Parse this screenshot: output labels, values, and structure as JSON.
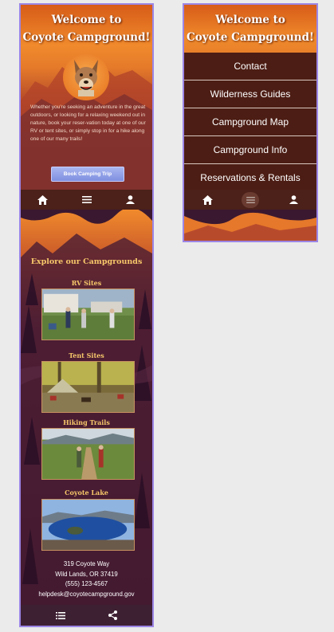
{
  "site": {
    "title_line1": "Welcome to",
    "title_line2": "Coyote Campground!"
  },
  "hero": {
    "intro": "Whether you're seeking an adventure in the great outdoors, or looking for a relaxing weekend out in nature, book your reser-vation today at one of our RV or tent sites, or simply stop in for a hike along one of our many trails!",
    "book_button": "Book Camping Trip"
  },
  "nav": {
    "home_icon": "home-icon",
    "menu_icon": "menu-icon",
    "account_icon": "person-icon"
  },
  "explore": {
    "title": "Explore our Campgrounds",
    "cards": [
      {
        "label": "RV Sites"
      },
      {
        "label": "Tent Sites"
      },
      {
        "label": "Hiking Trails"
      },
      {
        "label": "Coyote Lake"
      }
    ]
  },
  "contact": {
    "street": "319 Coyote Way",
    "city": "Wild Lands, OR 37419",
    "phone": "(555) 123-4567",
    "email": "helpdesk@coyotecampground.gov"
  },
  "footer": {
    "list_icon": "list-icon",
    "share_icon": "share-icon"
  },
  "menu": {
    "items": [
      {
        "label": "Contact"
      },
      {
        "label": "Wilderness Guides"
      },
      {
        "label": "Campground Map"
      },
      {
        "label": "Campground Info"
      },
      {
        "label": "Reservations & Rentals"
      }
    ]
  },
  "colors": {
    "accent_border": "#9c86e6",
    "title_gold": "#f7c86a",
    "nav_brown": "#4b2119",
    "button_blue": "#8c9ae6"
  }
}
